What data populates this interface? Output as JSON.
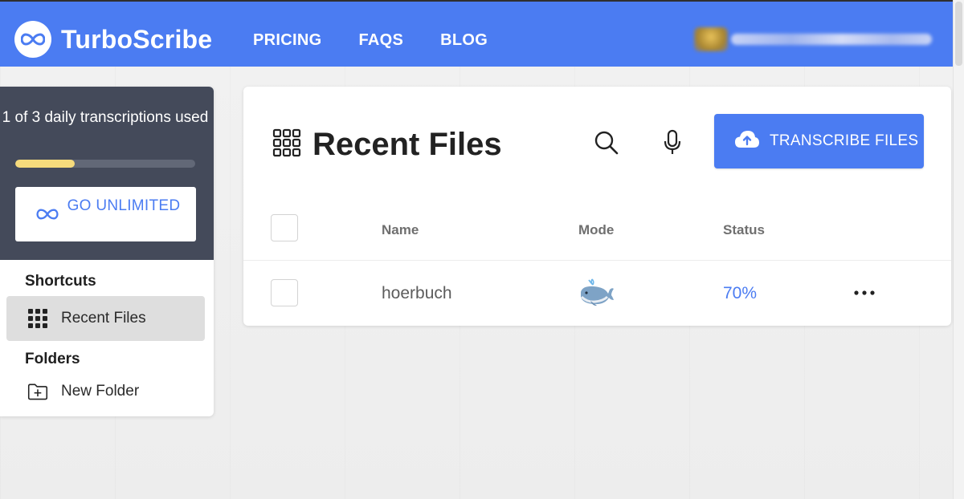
{
  "header": {
    "brand": "TurboScribe",
    "nav": [
      "PRICING",
      "FAQS",
      "BLOG"
    ],
    "colors": {
      "primary": "#4b7cf2",
      "accent_yellow": "#f6db7c"
    }
  },
  "sidebar": {
    "quota_text": "1 of 3 daily transcriptions used",
    "quota_progress_fraction": 0.33,
    "go_unlimited_label": "GO UNLIMITED",
    "shortcuts_heading": "Shortcuts",
    "shortcut_items": [
      {
        "label": "Recent Files",
        "icon": "grid-icon",
        "active": true
      }
    ],
    "folders_heading": "Folders",
    "folder_items": [
      {
        "label": "New Folder",
        "icon": "folder-plus-icon"
      }
    ]
  },
  "main": {
    "title": "Recent Files",
    "transcribe_button": "TRANSCRIBE FILES",
    "columns": [
      "Name",
      "Mode",
      "Status"
    ],
    "rows": [
      {
        "name": "hoerbuch",
        "mode_icon": "whale-icon",
        "status": "70%"
      }
    ]
  }
}
